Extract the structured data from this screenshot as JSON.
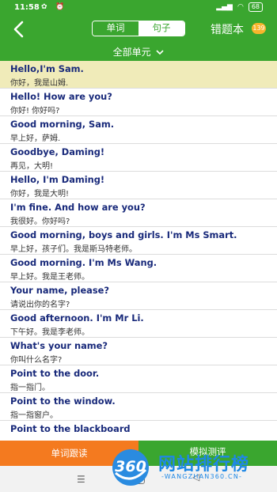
{
  "status": {
    "time": "11:58",
    "battery": "68"
  },
  "header": {
    "tabs": [
      {
        "label": "单词",
        "active": false
      },
      {
        "label": "句子",
        "active": true
      }
    ],
    "wrong_book_label": "错题本",
    "wrong_book_count": "139",
    "unit_selector": "全部单元"
  },
  "sentences": [
    {
      "en": "Hello,I'm Sam.",
      "zh": "你好，我是山姆.",
      "current": true
    },
    {
      "en": "Hello! How are you?",
      "zh": "你好! 你好吗?"
    },
    {
      "en": "Good morning, Sam.",
      "zh": "早上好，萨姆."
    },
    {
      "en": "Goodbye, Daming!",
      "zh": "再见，大明!"
    },
    {
      "en": "Hello, I'm Daming!",
      "zh": "你好，我是大明!"
    },
    {
      "en": "I'm fine. And how are you?",
      "zh": "我很好。你好吗?"
    },
    {
      "en": "Good morning, boys and girls. I'm Ms Smart.",
      "zh": "早上好，孩子们。我是斯马特老师。"
    },
    {
      "en": "Good morning. I'm Ms Wang.",
      "zh": "早上好。我是王老师。"
    },
    {
      "en": "Your name, please?",
      "zh": "请说出你的名字?"
    },
    {
      "en": "Good afternoon. I'm Mr Li.",
      "zh": "下午好。我是李老师。"
    },
    {
      "en": "What's your name?",
      "zh": "你叫什么名字?"
    },
    {
      "en": "Point to the door.",
      "zh": "指一指门。"
    },
    {
      "en": "Point to the window.",
      "zh": "指一指窗户。"
    },
    {
      "en": "Point to the blackboard",
      "zh": ""
    }
  ],
  "bottom_buttons": {
    "follow": "单词跟读",
    "test": "模拟测评"
  },
  "watermark": {
    "logo": "360",
    "title": "网站排行榜",
    "subtitle": "-WANGZHAN360.CN-"
  },
  "colors": {
    "primary": "#3aa62f",
    "accent": "#f47a1f",
    "highlight": "#f0ebb9",
    "sentence_text": "#18297a"
  }
}
